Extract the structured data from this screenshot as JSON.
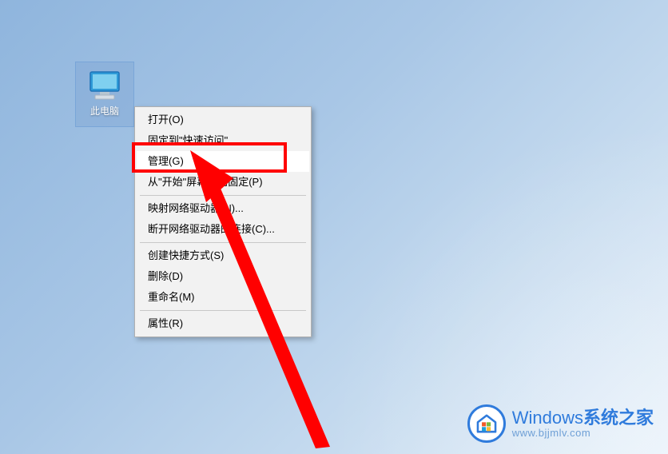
{
  "desktop": {
    "icon_label": "此电脑"
  },
  "context_menu": {
    "items": [
      {
        "label": "打开(O)",
        "highlight": false
      },
      {
        "label": "固定到\"快速访问\"",
        "highlight": false
      },
      {
        "label": "管理(G)",
        "highlight": true
      },
      {
        "label": "从\"开始\"屏幕取消固定(P)",
        "highlight": false
      },
      {
        "sep": true
      },
      {
        "label": "映射网络驱动器(N)...",
        "highlight": false
      },
      {
        "label": "断开网络驱动器的连接(C)...",
        "highlight": false
      },
      {
        "sep": true
      },
      {
        "label": "创建快捷方式(S)",
        "highlight": false
      },
      {
        "label": "删除(D)",
        "highlight": false
      },
      {
        "label": "重命名(M)",
        "highlight": false
      },
      {
        "sep": true
      },
      {
        "label": "属性(R)",
        "highlight": false
      }
    ]
  },
  "annotation": {
    "highlight_target": "管理(G)",
    "arrow_color": "#ff0000"
  },
  "watermark": {
    "title_brand": "Windows",
    "title_suffix": "系统之家",
    "subtitle": "www.bjjmlv.com"
  }
}
